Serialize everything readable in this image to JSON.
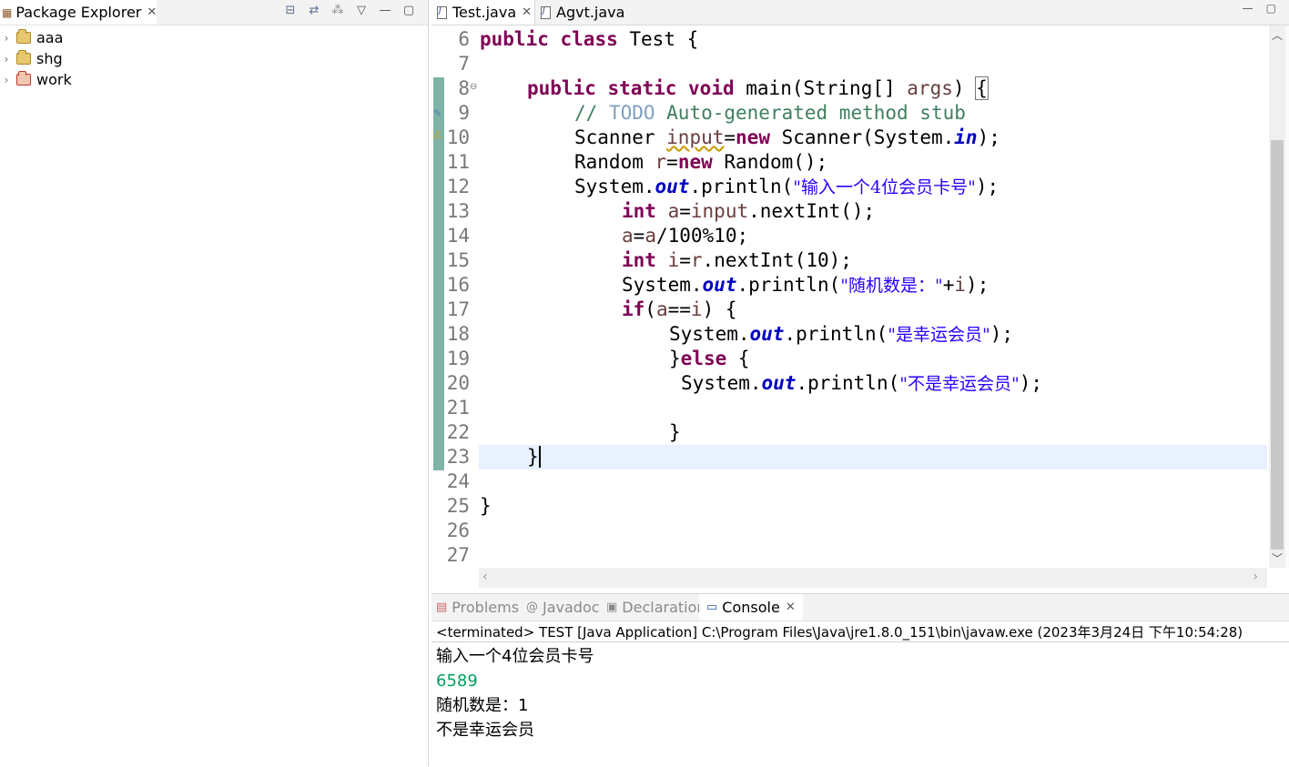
{
  "explorer": {
    "tab_label": "Package Explorer",
    "projects": [
      {
        "name": "aaa"
      },
      {
        "name": "shg"
      },
      {
        "name": "work"
      }
    ]
  },
  "editor": {
    "tabs": [
      {
        "label": "Test.java",
        "active": true
      },
      {
        "label": "Agvt.java",
        "active": false
      }
    ],
    "line_numbers": [
      "6",
      "7",
      "8",
      "9",
      "10",
      "11",
      "12",
      "13",
      "14",
      "15",
      "16",
      "17",
      "18",
      "19",
      "20",
      "21",
      "22",
      "23",
      "24",
      "25",
      "26",
      "27"
    ],
    "code": {
      "l6_a": "public",
      "l6_b": "class",
      "l6_c": "Test {",
      "l8_a": "public",
      "l8_b": "static",
      "l8_c": "void",
      "l8_d": "main(String[] ",
      "l8_e": "args",
      "l8_f": ") ",
      "l8_g": "{",
      "l9_a": "// ",
      "l9_b": "TODO",
      "l9_c": " Auto-generated method stub",
      "l10_a": "Scanner ",
      "l10_b": "input",
      "l10_c": "=",
      "l10_d": "new",
      "l10_e": " Scanner(System.",
      "l10_f": "in",
      "l10_g": ");",
      "l11_a": "Random ",
      "l11_b": "r",
      "l11_c": "=",
      "l11_d": "new",
      "l11_e": " Random();",
      "l12_a": "System.",
      "l12_b": "out",
      "l12_c": ".println(",
      "l12_d": "\"输入一个4位会员卡号\"",
      "l12_e": ");",
      "l13_a": "int",
      "l13_b": " a",
      "l13_c": "=",
      "l13_d": "input",
      "l13_e": ".nextInt();",
      "l14_a": "a",
      "l14_b": "=",
      "l14_c": "a",
      "l14_d": "/100%10;",
      "l15_a": "int",
      "l15_b": " i",
      "l15_c": "=",
      "l15_d": "r",
      "l15_e": ".nextInt(10);",
      "l16_a": "System.",
      "l16_b": "out",
      "l16_c": ".println(",
      "l16_d": "\"随机数是：\"",
      "l16_e": "+",
      "l16_f": "i",
      "l16_g": ");",
      "l17_a": "if",
      "l17_b": "(",
      "l17_c": "a",
      "l17_d": "==",
      "l17_e": "i",
      "l17_f": ") {",
      "l18_a": "System.",
      "l18_b": "out",
      "l18_c": ".println(",
      "l18_d": "\"是幸运会员\"",
      "l18_e": ");",
      "l19_a": "}",
      "l19_b": "else",
      "l19_c": " {",
      "l20_a": "System.",
      "l20_b": "out",
      "l20_c": ".println(",
      "l20_d": "\"不是幸运会员\"",
      "l20_e": ");",
      "l22_a": "}",
      "l23_a": "}",
      "l25_a": "}"
    }
  },
  "console": {
    "tabs": [
      {
        "label": "Problems"
      },
      {
        "label": "Javadoc"
      },
      {
        "label": "Declaration"
      },
      {
        "label": "Console"
      }
    ],
    "status": "<terminated> TEST [Java Application] C:\\Program Files\\Java\\jre1.8.0_151\\bin\\javaw.exe (2023年3月24日 下午10:54:28)",
    "output": [
      "输入一个4位会员卡号",
      "6589",
      "随机数是：1",
      "不是幸运会员"
    ]
  },
  "colors": {
    "keyword": "#7f0055",
    "comment": "#3f7f5f",
    "string": "#2a00ff",
    "field": "#0000c0",
    "console_input": "#00a060",
    "current_line": "#e8f2fe"
  }
}
